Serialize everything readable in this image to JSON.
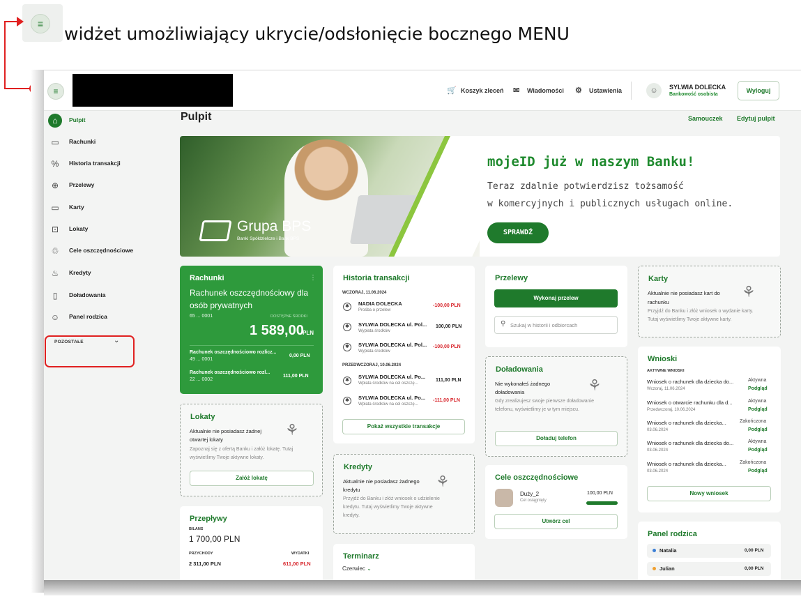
{
  "annotation": {
    "text": "widżet umożliwiający ukrycie/odsłonięcie bocznego MENU",
    "menu_glyph": "≡",
    "color": "#e02020"
  },
  "topbar": {
    "cart": "Koszyk zleceń",
    "messages": "Wiadomości",
    "settings": "Ustawienia",
    "user_name": "SYLWIA DOLECKA",
    "user_sub": "Bankowość osobista",
    "logout": "Wyloguj"
  },
  "sidebar": {
    "items": [
      {
        "label": "Pulpit",
        "icon": "home-icon",
        "glyph": "⌂"
      },
      {
        "label": "Rachunki",
        "icon": "wallet-icon",
        "glyph": "▭"
      },
      {
        "label": "Historia transakcji",
        "icon": "history-icon",
        "glyph": "%"
      },
      {
        "label": "Przelewy",
        "icon": "transfer-icon",
        "glyph": "⊕"
      },
      {
        "label": "Karty",
        "icon": "card-icon",
        "glyph": "▭"
      },
      {
        "label": "Lokaty",
        "icon": "deposit-icon",
        "glyph": "⊡"
      },
      {
        "label": "Cele oszczędnościowe",
        "icon": "piggy-bank-icon",
        "glyph": "♲"
      },
      {
        "label": "Kredyty",
        "icon": "loan-icon",
        "glyph": "♨"
      },
      {
        "label": "Doładowania",
        "icon": "phone-icon",
        "glyph": "▯"
      },
      {
        "label": "Panel rodzica",
        "icon": "parent-icon",
        "glyph": "☺"
      }
    ],
    "more": "POZOSTAŁE",
    "more_chevron": "⌄"
  },
  "main": {
    "title": "Pulpit",
    "tutorial": "Samouczek",
    "edit": "Edytuj pulpit"
  },
  "banner": {
    "brand": "Grupa BPS",
    "brand_sub": "Banki Spółdzielcze i Bank BPS",
    "headline": "mojeID już w naszym Banku!",
    "line1": "Teraz zdalnie potwierdzisz tożsamość",
    "line2": "w komercyjnych i publicznych usługach online.",
    "button": "SPRAWDŹ"
  },
  "rachunki": {
    "title": "Rachunki",
    "account_name_1": "Rachunek oszczędnościowy dla",
    "account_name_2": "osób prywatnych",
    "account_no": "65 ... 0001",
    "available_label": "DOSTĘPNE ŚRODKI",
    "balance": "1 589,00",
    "currency": "PLN",
    "sub": [
      {
        "name": "Rachunek oszczędnościowo rozlicz...",
        "no": "49 ... 0001",
        "amount": "0,00 PLN"
      },
      {
        "name": "Rachunek oszczędnościowo rozl...",
        "no": "22 ... 0002",
        "amount": "111,00 PLN"
      }
    ]
  },
  "historia": {
    "title": "Historia transakcji",
    "day1": "WCZORAJ, 11.06.2024",
    "day2": "PRZEDWCZORAJ, 10.06.2024",
    "tx": [
      {
        "name": "NADIA DOLECKA",
        "desc": "Prośba o przelew",
        "amount": "-100,00 PLN",
        "neg": true
      },
      {
        "name": "SYLWIA DOLECKA ul. Pol...",
        "desc": "Wypłata środków",
        "amount": "100,00 PLN",
        "neg": false
      },
      {
        "name": "SYLWIA DOLECKA ul. Pol...",
        "desc": "Wypłata środków",
        "amount": "-100,00 PLN",
        "neg": true
      },
      {
        "name": "SYLWIA DOLECKA ul. Po...",
        "desc": "Wpłata środków na cel oszczę...",
        "amount": "111,00 PLN",
        "neg": false
      },
      {
        "name": "SYLWIA DOLECKA ul. Po...",
        "desc": "Wpłata środków na cel oszczę...",
        "amount": "-111,00 PLN",
        "neg": true
      }
    ],
    "show_all": "Pokaż wszystkie transakcje"
  },
  "przelewy": {
    "title": "Przelewy",
    "button": "Wykonaj przelew",
    "search_placeholder": "Szukaj w historii i odbiorcach"
  },
  "karty": {
    "title": "Karty",
    "msg1": "Aktualnie nie posiadasz kart do",
    "msg2": "rachunku",
    "info1": "Przyjdź do Banku i złóż wniosek o wydanie karty.",
    "info2": "Tutaj wyświetlimy Twoje aktywne karty."
  },
  "doladowania": {
    "title": "Doładowania",
    "msg1": "Nie wykonałeś żadnego",
    "msg2": "doładowania",
    "info1": "Gdy zrealizujesz swoje pierwsze doładowanie",
    "info2": "telefonu, wyświetlimy je w tym miejscu.",
    "button": "Doładuj telefon"
  },
  "wnioski": {
    "title": "Wnioski",
    "sub": "AKTYWNE WNIOSKI",
    "items": [
      {
        "name": "Wniosek o rachunek dla dziecka do...",
        "date": "Wczoraj, 11.06.2024",
        "status": "Aktywna",
        "link": "Podgląd"
      },
      {
        "name": "Wniosek o otwarcie rachunku dla d...",
        "date": "Przedwczoraj, 10.06.2024",
        "status": "Aktywna",
        "link": "Podgląd"
      },
      {
        "name": "Wniosek o rachunek dla dziecka...",
        "date": "03.06.2024",
        "status": "Zakończona",
        "link": "Podgląd"
      },
      {
        "name": "Wniosek o rachunek dla dziecka do...",
        "date": "03.06.2024",
        "status": "Aktywna",
        "link": "Podgląd"
      },
      {
        "name": "Wniosek o rachunek dla dziecka...",
        "date": "03.06.2024",
        "status": "Zakończona",
        "link": "Podgląd"
      }
    ],
    "button": "Nowy wniosek"
  },
  "lokaty": {
    "title": "Lokaty",
    "msg1": "Aktualnie nie posiadasz żadnej",
    "msg2": "otwartej lokaty",
    "info1": "Zapoznaj się z ofertą Banku i załóż lokatę. Tutaj",
    "info2": "wyświetlimy Twoje aktywne lokaty.",
    "button": "Załóż lokatę"
  },
  "kredyty": {
    "title": "Kredyty",
    "msg1": "Aktualnie nie posiadasz żadnego",
    "msg2": "kredytu",
    "info1": "Przyjdź do Banku i złóż wniosek o udzielenie",
    "info2": "kredytu. Tutaj wyświetlimy Twoje aktywne",
    "info3": "kredyty."
  },
  "cele": {
    "title": "Cele oszczędnościowe",
    "goal_name": "Duży_2",
    "goal_status": "Cel osiągnięty",
    "goal_amount": "100,00 PLN",
    "goal_progress": 1.0,
    "button": "Utwórz cel"
  },
  "przeplywy": {
    "title": "Przepływy",
    "bilans_label": "BILANS",
    "bilans": "1 700,00 PLN",
    "income_label": "PRZYCHODY",
    "income": "2 311,00 PLN",
    "expense_label": "WYDATKI",
    "expense": "611,00 PLN"
  },
  "terminarz": {
    "title": "Terminarz",
    "month": "Czerwiec"
  },
  "panel": {
    "title": "Panel rodzica",
    "children": [
      {
        "name": "Natalia",
        "amount": "0,00 PLN",
        "color": "#3b7fd6"
      },
      {
        "name": "Julian",
        "amount": "0,00 PLN",
        "color": "#f0a030"
      }
    ]
  },
  "colors": {
    "accent": "#1f7a2c",
    "negative": "#d8262c",
    "brand_green": "#2e9a3c"
  }
}
